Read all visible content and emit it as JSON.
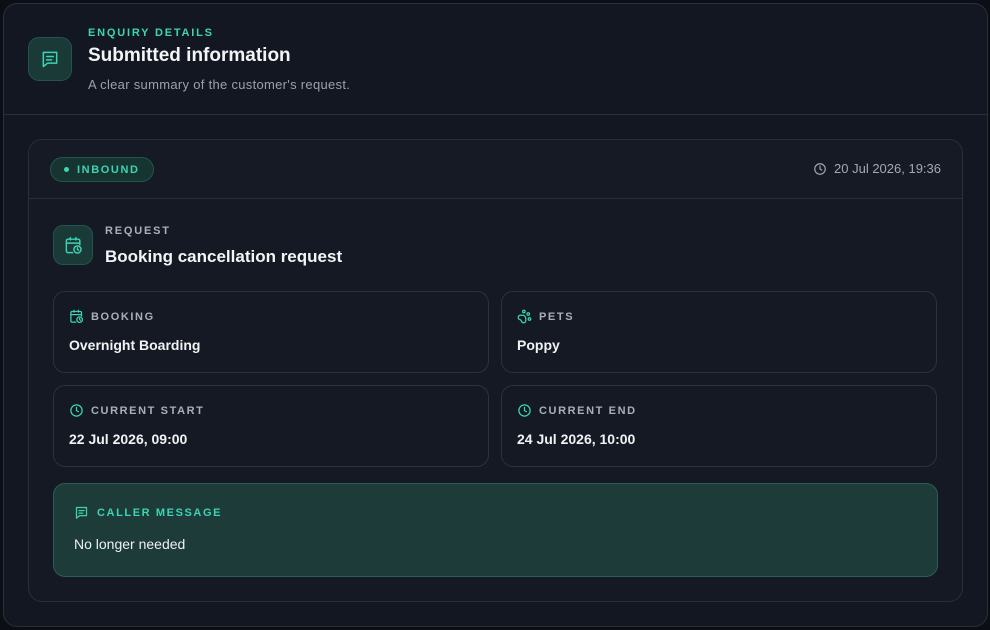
{
  "header": {
    "eyebrow": "ENQUIRY DETAILS",
    "title": "Submitted information",
    "subtitle": "A clear summary of the customer's request.",
    "icon": "message-square-text-icon"
  },
  "card": {
    "badge": "INBOUND",
    "timestamp": "20 Jul 2026, 19:36",
    "request": {
      "label": "REQUEST",
      "title": "Booking cancellation request",
      "icon": "calendar-clock-icon"
    },
    "fields": {
      "booking": {
        "label": "BOOKING",
        "value": "Overnight Boarding",
        "icon": "calendar-clock-icon"
      },
      "pets": {
        "label": "PETS",
        "value": "Poppy",
        "icon": "paw-print-icon"
      },
      "current_start": {
        "label": "CURRENT START",
        "value": "22 Jul 2026, 09:00",
        "icon": "clock-icon"
      },
      "current_end": {
        "label": "CURRENT END",
        "value": "24 Jul 2026, 10:00",
        "icon": "clock-icon"
      }
    },
    "message": {
      "label": "CALLER MESSAGE",
      "text": "No longer needed",
      "icon": "message-square-text-icon"
    }
  },
  "colors": {
    "accent": "#3ed3b3",
    "background": "#131722",
    "message_bg": "#1c3b39"
  }
}
